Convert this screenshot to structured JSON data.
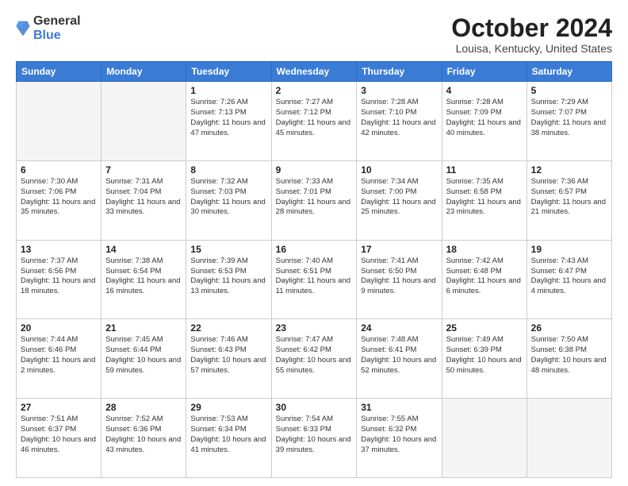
{
  "header": {
    "logo_general": "General",
    "logo_blue": "Blue",
    "month_title": "October 2024",
    "location": "Louisa, Kentucky, United States"
  },
  "days_of_week": [
    "Sunday",
    "Monday",
    "Tuesday",
    "Wednesday",
    "Thursday",
    "Friday",
    "Saturday"
  ],
  "weeks": [
    [
      {
        "num": "",
        "info": ""
      },
      {
        "num": "",
        "info": ""
      },
      {
        "num": "1",
        "info": "Sunrise: 7:26 AM\nSunset: 7:13 PM\nDaylight: 11 hours and 47 minutes."
      },
      {
        "num": "2",
        "info": "Sunrise: 7:27 AM\nSunset: 7:12 PM\nDaylight: 11 hours and 45 minutes."
      },
      {
        "num": "3",
        "info": "Sunrise: 7:28 AM\nSunset: 7:10 PM\nDaylight: 11 hours and 42 minutes."
      },
      {
        "num": "4",
        "info": "Sunrise: 7:28 AM\nSunset: 7:09 PM\nDaylight: 11 hours and 40 minutes."
      },
      {
        "num": "5",
        "info": "Sunrise: 7:29 AM\nSunset: 7:07 PM\nDaylight: 11 hours and 38 minutes."
      }
    ],
    [
      {
        "num": "6",
        "info": "Sunrise: 7:30 AM\nSunset: 7:06 PM\nDaylight: 11 hours and 35 minutes."
      },
      {
        "num": "7",
        "info": "Sunrise: 7:31 AM\nSunset: 7:04 PM\nDaylight: 11 hours and 33 minutes."
      },
      {
        "num": "8",
        "info": "Sunrise: 7:32 AM\nSunset: 7:03 PM\nDaylight: 11 hours and 30 minutes."
      },
      {
        "num": "9",
        "info": "Sunrise: 7:33 AM\nSunset: 7:01 PM\nDaylight: 11 hours and 28 minutes."
      },
      {
        "num": "10",
        "info": "Sunrise: 7:34 AM\nSunset: 7:00 PM\nDaylight: 11 hours and 25 minutes."
      },
      {
        "num": "11",
        "info": "Sunrise: 7:35 AM\nSunset: 6:58 PM\nDaylight: 11 hours and 23 minutes."
      },
      {
        "num": "12",
        "info": "Sunrise: 7:36 AM\nSunset: 6:57 PM\nDaylight: 11 hours and 21 minutes."
      }
    ],
    [
      {
        "num": "13",
        "info": "Sunrise: 7:37 AM\nSunset: 6:56 PM\nDaylight: 11 hours and 18 minutes."
      },
      {
        "num": "14",
        "info": "Sunrise: 7:38 AM\nSunset: 6:54 PM\nDaylight: 11 hours and 16 minutes."
      },
      {
        "num": "15",
        "info": "Sunrise: 7:39 AM\nSunset: 6:53 PM\nDaylight: 11 hours and 13 minutes."
      },
      {
        "num": "16",
        "info": "Sunrise: 7:40 AM\nSunset: 6:51 PM\nDaylight: 11 hours and 11 minutes."
      },
      {
        "num": "17",
        "info": "Sunrise: 7:41 AM\nSunset: 6:50 PM\nDaylight: 11 hours and 9 minutes."
      },
      {
        "num": "18",
        "info": "Sunrise: 7:42 AM\nSunset: 6:48 PM\nDaylight: 11 hours and 6 minutes."
      },
      {
        "num": "19",
        "info": "Sunrise: 7:43 AM\nSunset: 6:47 PM\nDaylight: 11 hours and 4 minutes."
      }
    ],
    [
      {
        "num": "20",
        "info": "Sunrise: 7:44 AM\nSunset: 6:46 PM\nDaylight: 11 hours and 2 minutes."
      },
      {
        "num": "21",
        "info": "Sunrise: 7:45 AM\nSunset: 6:44 PM\nDaylight: 10 hours and 59 minutes."
      },
      {
        "num": "22",
        "info": "Sunrise: 7:46 AM\nSunset: 6:43 PM\nDaylight: 10 hours and 57 minutes."
      },
      {
        "num": "23",
        "info": "Sunrise: 7:47 AM\nSunset: 6:42 PM\nDaylight: 10 hours and 55 minutes."
      },
      {
        "num": "24",
        "info": "Sunrise: 7:48 AM\nSunset: 6:41 PM\nDaylight: 10 hours and 52 minutes."
      },
      {
        "num": "25",
        "info": "Sunrise: 7:49 AM\nSunset: 6:39 PM\nDaylight: 10 hours and 50 minutes."
      },
      {
        "num": "26",
        "info": "Sunrise: 7:50 AM\nSunset: 6:38 PM\nDaylight: 10 hours and 48 minutes."
      }
    ],
    [
      {
        "num": "27",
        "info": "Sunrise: 7:51 AM\nSunset: 6:37 PM\nDaylight: 10 hours and 46 minutes."
      },
      {
        "num": "28",
        "info": "Sunrise: 7:52 AM\nSunset: 6:36 PM\nDaylight: 10 hours and 43 minutes."
      },
      {
        "num": "29",
        "info": "Sunrise: 7:53 AM\nSunset: 6:34 PM\nDaylight: 10 hours and 41 minutes."
      },
      {
        "num": "30",
        "info": "Sunrise: 7:54 AM\nSunset: 6:33 PM\nDaylight: 10 hours and 39 minutes."
      },
      {
        "num": "31",
        "info": "Sunrise: 7:55 AM\nSunset: 6:32 PM\nDaylight: 10 hours and 37 minutes."
      },
      {
        "num": "",
        "info": ""
      },
      {
        "num": "",
        "info": ""
      }
    ]
  ]
}
